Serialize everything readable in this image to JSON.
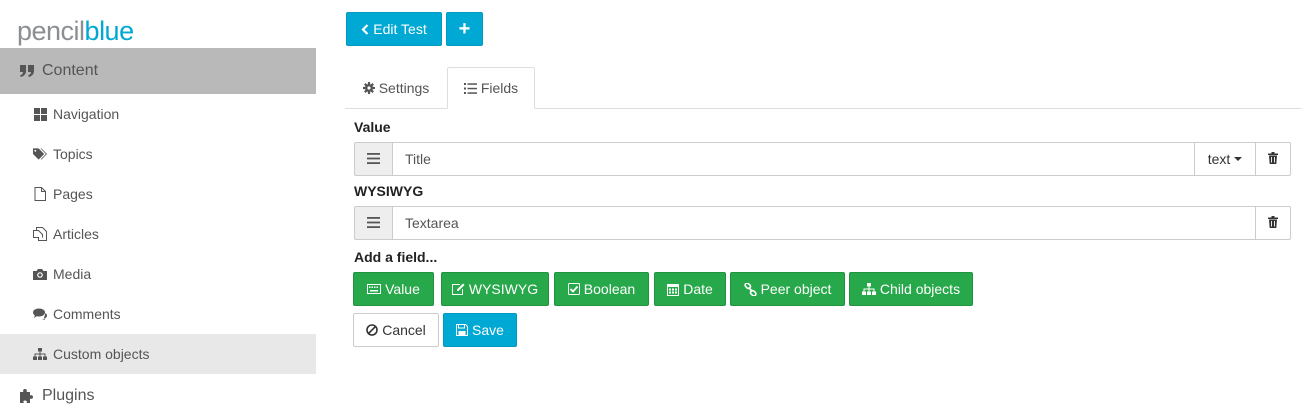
{
  "logo": {
    "part1": "pencil",
    "part2": "blue"
  },
  "sidebar": {
    "content_label": "Content",
    "items": [
      {
        "label": "Navigation",
        "icon": "th-large-icon"
      },
      {
        "label": "Topics",
        "icon": "tags-icon"
      },
      {
        "label": "Pages",
        "icon": "file-icon"
      },
      {
        "label": "Articles",
        "icon": "files-icon"
      },
      {
        "label": "Media",
        "icon": "camera-icon"
      },
      {
        "label": "Comments",
        "icon": "comments-icon"
      },
      {
        "label": "Custom objects",
        "icon": "sitemap-icon"
      }
    ],
    "plugins_label": "Plugins"
  },
  "toolbar": {
    "edit_label": "Edit Test",
    "add_label": "+"
  },
  "tabs": [
    {
      "label": "Settings"
    },
    {
      "label": "Fields"
    }
  ],
  "fields": [
    {
      "heading": "Value",
      "name": "Title",
      "type": "text"
    },
    {
      "heading": "WYSIWYG",
      "name": "Textarea"
    }
  ],
  "add_field": {
    "heading": "Add a field...",
    "buttons": [
      "Value",
      "WYSIWYG",
      "Boolean",
      "Date",
      "Peer object",
      "Child objects"
    ]
  },
  "actions": {
    "cancel": "Cancel",
    "save": "Save"
  },
  "colors": {
    "accent": "#00a8d4",
    "success": "#27a84a",
    "active_nav": "#b9b9b9"
  }
}
